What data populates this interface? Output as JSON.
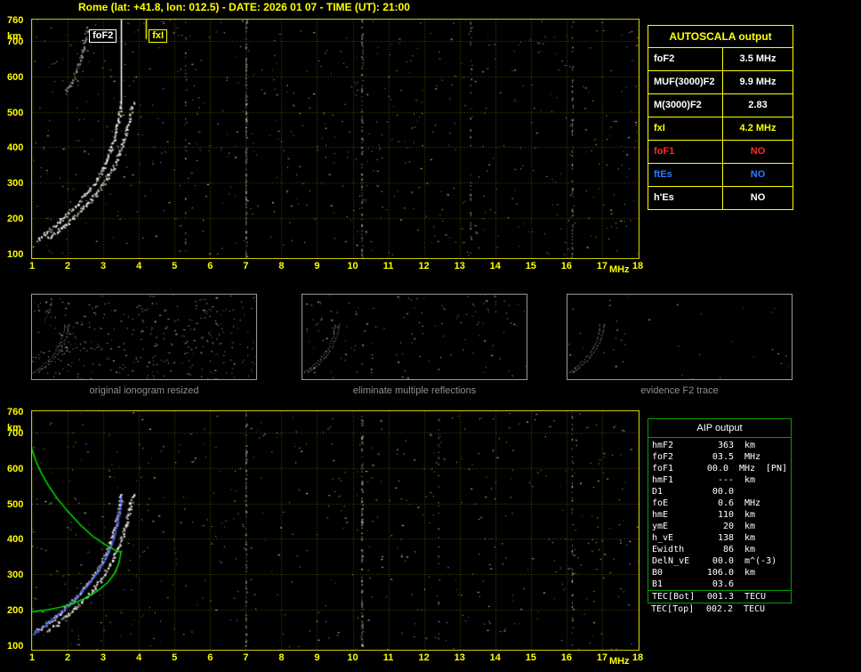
{
  "title": "Rome (lat: +41.8, lon: 012.5) - DATE: 2026 01 07 - TIME (UT): 21:00",
  "autoscala": {
    "title": "AUTOSCALA output",
    "rows": [
      {
        "label": "foF2",
        "value": "3.5 MHz",
        "color": "#ffffff"
      },
      {
        "label": "MUF(3000)F2",
        "value": "9.9 MHz",
        "color": "#ffffff"
      },
      {
        "label": "M(3000)F2",
        "value": "2.83",
        "color": "#ffffff"
      },
      {
        "label": "fxI",
        "value": "4.2 MHz",
        "color": "#ffff00"
      },
      {
        "label": "foF1",
        "value": "NO",
        "color": "#ff2a2a"
      },
      {
        "label": "ftEs",
        "value": "NO",
        "color": "#2b7bff"
      },
      {
        "label": "h'Es",
        "value": "NO",
        "color": "#ffffff"
      }
    ]
  },
  "aip": {
    "title": "AIP output",
    "rows": [
      {
        "label": "hmF2",
        "value": "363",
        "unit": "km",
        "extra": ""
      },
      {
        "label": "foF2",
        "value": "03.5",
        "unit": "MHz",
        "extra": ""
      },
      {
        "label": "foF1",
        "value": "00.0",
        "unit": "MHz",
        "extra": "[PN]"
      },
      {
        "label": "hmF1",
        "value": "---",
        "unit": "km",
        "extra": ""
      },
      {
        "label": "D1",
        "value": "00.0",
        "unit": "",
        "extra": ""
      },
      {
        "label": "foE",
        "value": "0.6",
        "unit": "MHz",
        "extra": ""
      },
      {
        "label": "hmE",
        "value": "110",
        "unit": "km",
        "extra": ""
      },
      {
        "label": "ymE",
        "value": "20",
        "unit": "km",
        "extra": ""
      },
      {
        "label": "h_vE",
        "value": "138",
        "unit": "km",
        "extra": ""
      },
      {
        "label": "Ewidth",
        "value": "86",
        "unit": "km",
        "extra": ""
      },
      {
        "label": "DelN_vE",
        "value": "00.0",
        "unit": "m^(-3)",
        "extra": ""
      },
      {
        "label": "B0",
        "value": "106.0",
        "unit": "km",
        "extra": ""
      },
      {
        "label": "B1",
        "value": "03.6",
        "unit": "",
        "extra": ""
      },
      {
        "label": "TEC[Bot]",
        "value": "001.3",
        "unit": "TECU",
        "extra": ""
      },
      {
        "label": "TEC[Top]",
        "value": "002.2",
        "unit": "TECU",
        "extra": ""
      }
    ]
  },
  "thumbnails": [
    {
      "caption": "original ionogram resized"
    },
    {
      "caption": "eliminate multiple reflections"
    },
    {
      "caption": "evidence F2 trace"
    }
  ],
  "colors": {
    "accent_yellow": "#ffff00",
    "plot_border": "#c8c800",
    "trace_white": "#ffffff",
    "profile_green": "#00e000",
    "restored_blue": "#4a6aff",
    "aip_border": "#00a000",
    "caption_gray": "#8f8f8f"
  },
  "chart_data": [
    {
      "id": "ionogram-top",
      "type": "scatter",
      "xlabel": "MHz",
      "ylabel": "km",
      "xlim": [
        1,
        18
      ],
      "ylim": [
        90,
        760
      ],
      "xticks": [
        1,
        2,
        3,
        4,
        5,
        6,
        7,
        8,
        9,
        10,
        11,
        12,
        13,
        14,
        15,
        16,
        17,
        18
      ],
      "ytick_labels": [
        760,
        700,
        600,
        500,
        400,
        300,
        200,
        100
      ],
      "grid": true,
      "noise_seed": 7,
      "noise_count": 640,
      "rfi_lines": [
        [
          7.0,
          0.5
        ],
        [
          10.25,
          0.35
        ],
        [
          5.3,
          0.1
        ],
        [
          13.3,
          0.15
        ],
        [
          16.15,
          0.25
        ]
      ],
      "markers": [
        {
          "name": "foF2",
          "freq": 3.5,
          "to_height": 520,
          "color": "#ffffff",
          "label": "foF2",
          "label_side": "left"
        },
        {
          "name": "fxI",
          "freq": 4.2,
          "to_height": 705,
          "color": "#ffff00",
          "label": "fxI",
          "label_side": "right"
        }
      ],
      "series": [
        {
          "name": "F2-O-trace",
          "color": "#ffffff",
          "style": "echo",
          "points": [
            [
              1.1,
              140
            ],
            [
              1.35,
              158
            ],
            [
              1.62,
              180
            ],
            [
              1.9,
              205
            ],
            [
              2.18,
              232
            ],
            [
              2.45,
              262
            ],
            [
              2.7,
              295
            ],
            [
              2.92,
              330
            ],
            [
              3.1,
              368
            ],
            [
              3.24,
              406
            ],
            [
              3.34,
              444
            ],
            [
              3.41,
              478
            ],
            [
              3.46,
              510
            ],
            [
              3.49,
              530
            ]
          ]
        },
        {
          "name": "F2-X-trace",
          "color": "#ffffff",
          "style": "echo",
          "points": [
            [
              1.42,
              142
            ],
            [
              1.66,
              160
            ],
            [
              1.92,
              182
            ],
            [
              2.2,
              207
            ],
            [
              2.48,
              234
            ],
            [
              2.74,
              264
            ],
            [
              2.98,
              297
            ],
            [
              3.2,
              332
            ],
            [
              3.38,
              370
            ],
            [
              3.52,
              408
            ],
            [
              3.63,
              446
            ],
            [
              3.72,
              480
            ],
            [
              3.79,
              512
            ],
            [
              3.84,
              532
            ]
          ]
        },
        {
          "name": "second-hop",
          "color": "#d8d8d8",
          "style": "echo",
          "alpha": 0.65,
          "points": [
            [
              1.95,
              555
            ],
            [
              2.1,
              585
            ],
            [
              2.25,
              620
            ],
            [
              2.38,
              658
            ],
            [
              2.48,
              700
            ],
            [
              2.55,
              740
            ]
          ]
        }
      ]
    },
    {
      "id": "ionogram-bottom",
      "type": "scatter",
      "xlabel": "MHz",
      "ylabel": "km",
      "xlim": [
        1,
        18
      ],
      "ylim": [
        90,
        760
      ],
      "xticks": [
        1,
        2,
        3,
        4,
        5,
        6,
        7,
        8,
        9,
        10,
        11,
        12,
        13,
        14,
        15,
        16,
        17,
        18
      ],
      "ytick_labels": [
        760,
        700,
        600,
        500,
        400,
        300,
        200,
        100
      ],
      "grid": true,
      "noise_seed": 13,
      "noise_count": 560,
      "rfi_lines": [
        [
          7.0,
          0.28
        ],
        [
          10.25,
          0.5
        ],
        [
          12.4,
          0.1
        ],
        [
          16.15,
          0.18
        ]
      ],
      "markers": [],
      "series": [
        {
          "name": "F2-O-trace",
          "color": "#ffffff",
          "style": "echo",
          "points": [
            [
              1.1,
              140
            ],
            [
              1.35,
              158
            ],
            [
              1.62,
              180
            ],
            [
              1.9,
              205
            ],
            [
              2.18,
              232
            ],
            [
              2.45,
              262
            ],
            [
              2.7,
              295
            ],
            [
              2.92,
              330
            ],
            [
              3.1,
              368
            ],
            [
              3.24,
              406
            ],
            [
              3.34,
              444
            ],
            [
              3.41,
              478
            ],
            [
              3.46,
              510
            ],
            [
              3.49,
              530
            ]
          ]
        },
        {
          "name": "F2-X-trace",
          "color": "#ffffff",
          "style": "echo",
          "points": [
            [
              1.42,
              142
            ],
            [
              1.66,
              160
            ],
            [
              1.92,
              182
            ],
            [
              2.2,
              207
            ],
            [
              2.48,
              234
            ],
            [
              2.74,
              264
            ],
            [
              2.98,
              297
            ],
            [
              3.2,
              332
            ],
            [
              3.38,
              370
            ],
            [
              3.52,
              408
            ],
            [
              3.63,
              446
            ],
            [
              3.72,
              480
            ],
            [
              3.79,
              512
            ],
            [
              3.84,
              532
            ]
          ]
        },
        {
          "name": "restored-trace",
          "color": "#4a6aff",
          "style": "echo",
          "jitter": 0.4,
          "points": [
            [
              1.02,
              132
            ],
            [
              1.2,
              146
            ],
            [
              1.45,
              166
            ],
            [
              1.72,
              190
            ],
            [
              2.0,
              214
            ],
            [
              2.28,
              242
            ],
            [
              2.55,
              272
            ],
            [
              2.8,
              306
            ],
            [
              3.02,
              342
            ],
            [
              3.2,
              380
            ],
            [
              3.32,
              418
            ],
            [
              3.41,
              456
            ],
            [
              3.46,
              492
            ],
            [
              3.49,
              522
            ]
          ]
        },
        {
          "name": "Ne-profile",
          "color": "#00e000",
          "style": "line",
          "points": [
            [
              1.0,
              652
            ],
            [
              1.1,
              622
            ],
            [
              1.25,
              588
            ],
            [
              1.45,
              552
            ],
            [
              1.7,
              515
            ],
            [
              2.0,
              478
            ],
            [
              2.35,
              440
            ],
            [
              2.7,
              408
            ],
            [
              3.05,
              384
            ],
            [
              3.3,
              370
            ],
            [
              3.45,
              364
            ],
            [
              3.5,
              363
            ],
            [
              3.44,
              332
            ],
            [
              3.32,
              303
            ],
            [
              3.12,
              277
            ],
            [
              2.85,
              254
            ],
            [
              2.52,
              234
            ],
            [
              2.15,
              218
            ],
            [
              1.78,
              207
            ],
            [
              1.42,
              200
            ],
            [
              1.12,
              196
            ],
            [
              1.0,
              194
            ]
          ]
        }
      ]
    }
  ]
}
